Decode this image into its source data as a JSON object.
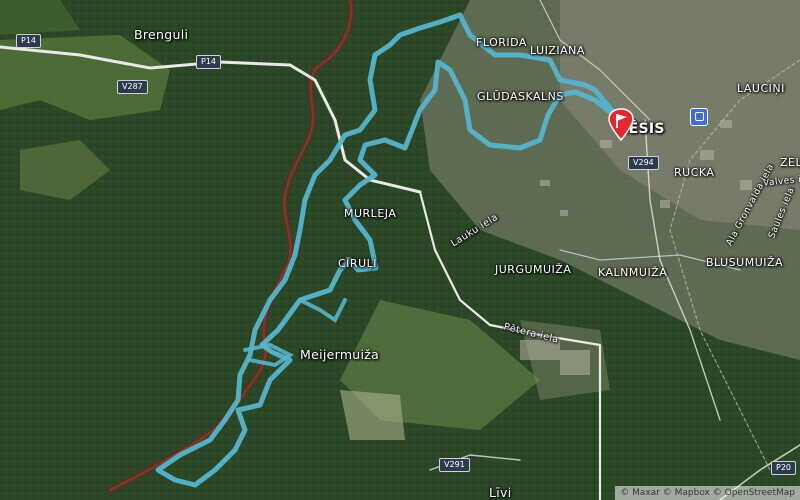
{
  "map": {
    "places": [
      {
        "id": "brenguli",
        "name": "Brenguli"
      },
      {
        "id": "florida",
        "name": "FLORIDA"
      },
      {
        "id": "luiziana",
        "name": "LUIZIANA"
      },
      {
        "id": "gludaskalns",
        "name": "GLŪDASKALNS"
      },
      {
        "id": "cesis",
        "name": "CĒSIS"
      },
      {
        "id": "laucini",
        "name": "LAUCIŅI"
      },
      {
        "id": "rucka",
        "name": "RUCKA"
      },
      {
        "id": "zeltini",
        "name": "ZEL"
      },
      {
        "id": "murleja",
        "name": "MURLEJA"
      },
      {
        "id": "cirulisi",
        "name": "CĪRUĻI"
      },
      {
        "id": "jurgumuiza",
        "name": "JURGUMUIŽA"
      },
      {
        "id": "kalnmuiza",
        "name": "KALNMUIŽA"
      },
      {
        "id": "blusumuiza",
        "name": "BLUSUMUIŽA"
      },
      {
        "id": "meijermuiza",
        "name": "Meijermuiža"
      },
      {
        "id": "livi",
        "name": "Līvi"
      }
    ],
    "streets": [
      {
        "id": "lauku-iela",
        "name": "Lauku iela"
      },
      {
        "id": "petera-iela",
        "name": "Pētera iela"
      },
      {
        "id": "valves-iela",
        "name": "Valves iela"
      },
      {
        "id": "ala-gronvalda-iela",
        "name": "Ala Gronvalda iela"
      },
      {
        "id": "saules-iela",
        "name": "Saules iela"
      }
    ],
    "road_shields": [
      {
        "id": "p14-west",
        "label": "P14"
      },
      {
        "id": "p14-mid",
        "label": "P14"
      },
      {
        "id": "v287",
        "label": "V287"
      },
      {
        "id": "v294",
        "label": "V294"
      },
      {
        "id": "v291",
        "label": "V291"
      },
      {
        "id": "p20",
        "label": "P20"
      }
    ],
    "attribution": "© Maxar © Mapbox © OpenStreetMap",
    "colors": {
      "route": "#56b4cc",
      "river": "#5a2f22",
      "road": "#e9e9e6",
      "forest": "#243d22",
      "marker": "#e8262f"
    },
    "icons": {
      "destination": "red-flag-marker-icon",
      "station": "train-station-icon"
    }
  }
}
